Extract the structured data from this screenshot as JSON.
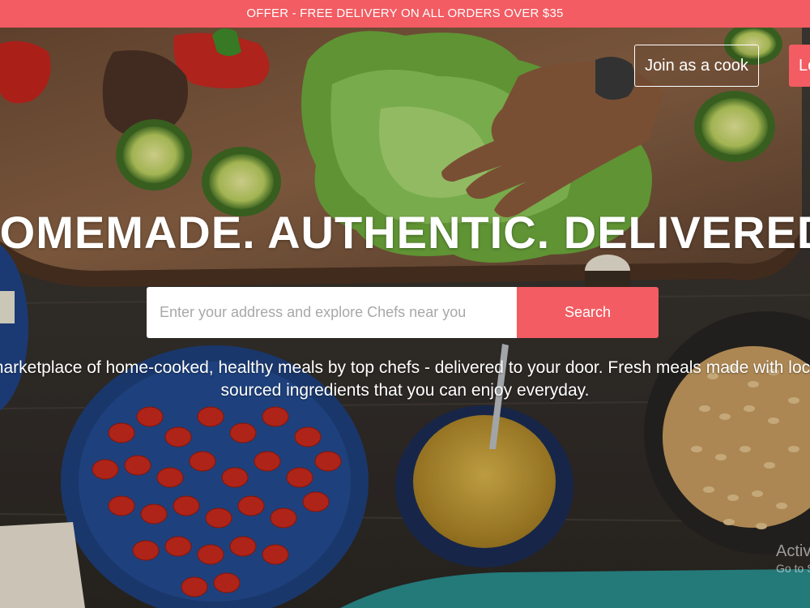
{
  "offer_bar": {
    "text": "OFFER - FREE DELIVERY ON ALL ORDERS OVER $35"
  },
  "header": {
    "join_label": "Join as a cook",
    "login_label": "Lo"
  },
  "hero": {
    "headline": "HOMEMADE. AUTHENTIC. DELIVERED.",
    "search": {
      "placeholder": "Enter your address and explore Chefs near you",
      "value": "",
      "button_label": "Search"
    },
    "tagline_line1": "A marketplace of home-cooked, healthy meals by top chefs - delivered to your door. Fresh meals made with locally",
    "tagline_line2": "sourced ingredients that you can enjoy everyday."
  },
  "watermark": {
    "title": "Activate Windows",
    "subtitle": "Go to Settings to activate Windows."
  },
  "colors": {
    "accent": "#f25c62",
    "text_on_dark": "#ffffff"
  }
}
